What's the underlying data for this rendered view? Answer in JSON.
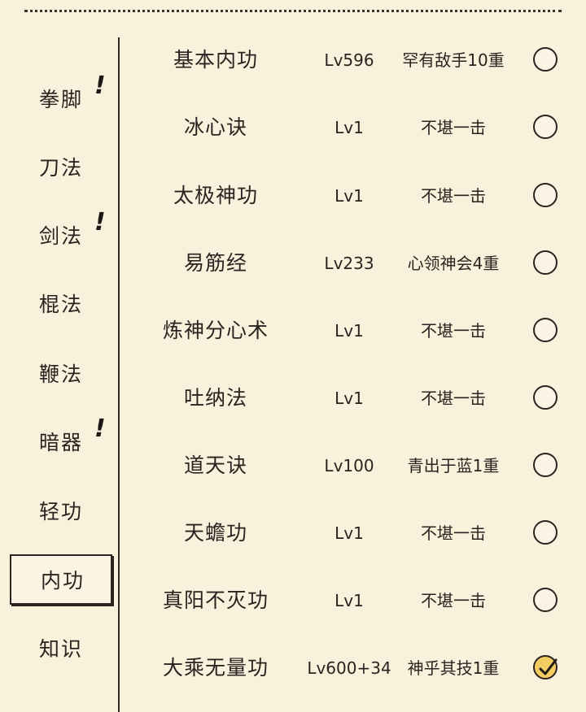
{
  "colors": {
    "background": "#f9f1dc",
    "ink": "#2a2420",
    "checked_fill": "#f3cd62"
  },
  "sidebar": {
    "items": [
      {
        "label": "拳脚",
        "alert": "!"
      },
      {
        "label": "刀法",
        "alert": ""
      },
      {
        "label": "剑法",
        "alert": "!"
      },
      {
        "label": "棍法",
        "alert": ""
      },
      {
        "label": "鞭法",
        "alert": ""
      },
      {
        "label": "暗器",
        "alert": "!"
      },
      {
        "label": "轻功",
        "alert": ""
      },
      {
        "label": "内功",
        "alert": "",
        "selected": true
      },
      {
        "label": "知识",
        "alert": ""
      }
    ]
  },
  "skills": [
    {
      "name": "基本内功",
      "level": "Lv596",
      "rank": "罕有敌手10重",
      "checked": false
    },
    {
      "name": "冰心诀",
      "level": "Lv1",
      "rank": "不堪一击",
      "checked": false
    },
    {
      "name": "太极神功",
      "level": "Lv1",
      "rank": "不堪一击",
      "checked": false
    },
    {
      "name": "易筋经",
      "level": "Lv233",
      "rank": "心领神会4重",
      "checked": false
    },
    {
      "name": "炼神分心术",
      "level": "Lv1",
      "rank": "不堪一击",
      "checked": false
    },
    {
      "name": "吐纳法",
      "level": "Lv1",
      "rank": "不堪一击",
      "checked": false
    },
    {
      "name": "道天诀",
      "level": "Lv100",
      "rank": "青出于蓝1重",
      "checked": false
    },
    {
      "name": "天蟾功",
      "level": "Lv1",
      "rank": "不堪一击",
      "checked": false
    },
    {
      "name": "真阳不灭功",
      "level": "Lv1",
      "rank": "不堪一击",
      "checked": false
    },
    {
      "name": "大乘无量功",
      "level": "Lv600+34",
      "rank": "神乎其技1重",
      "checked": true
    }
  ]
}
